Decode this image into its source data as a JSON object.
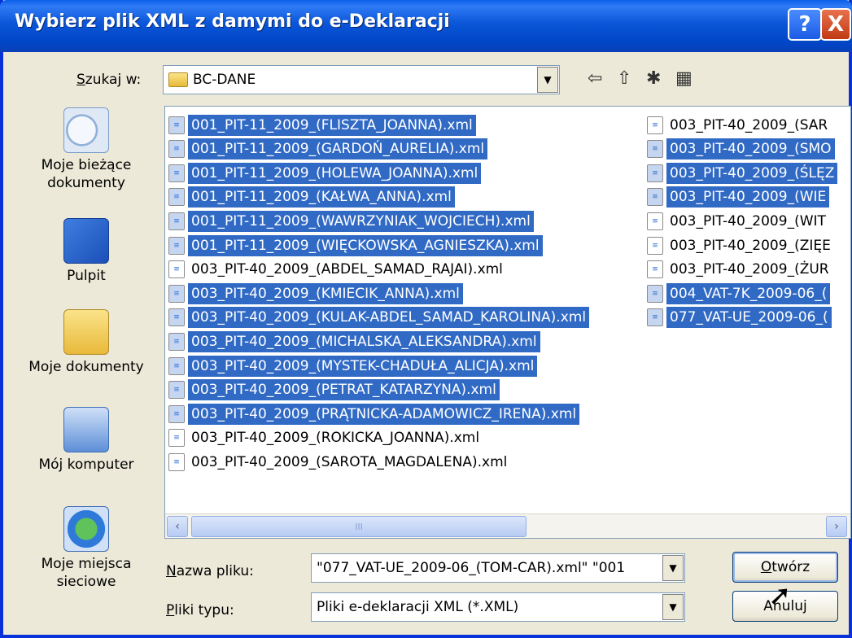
{
  "window": {
    "title": "Wybierz plik XML z damymi do e-Deklaracji"
  },
  "titlebar": {
    "help": "?",
    "close": "X"
  },
  "lookin": {
    "label_prefix": "S",
    "label_rest": "zukaj w:",
    "value": "BC-DANE"
  },
  "places": [
    {
      "name": "Moje bieżące dokumenty",
      "icon": "recent-documents-icon"
    },
    {
      "name": "Pulpit",
      "icon": "desktop-icon"
    },
    {
      "name": "Moje dokumenty",
      "icon": "my-documents-icon"
    },
    {
      "name": "Mój komputer",
      "icon": "my-computer-icon"
    },
    {
      "name": "Moje miejsca sieciowe",
      "icon": "network-places-icon"
    }
  ],
  "files": {
    "col1": [
      {
        "name": "001_PIT-11_2009_(FLISZTA_JOANNA).xml",
        "selected": true
      },
      {
        "name": "001_PIT-11_2009_(GARDOŃ_AURELIA).xml",
        "selected": true
      },
      {
        "name": "001_PIT-11_2009_(HOLEWA_JOANNA).xml",
        "selected": true
      },
      {
        "name": "001_PIT-11_2009_(KAŁWA_ANNA).xml",
        "selected": true
      },
      {
        "name": "001_PIT-11_2009_(WAWRZYNIAK_WOJCIECH).xml",
        "selected": true
      },
      {
        "name": "001_PIT-11_2009_(WIĘCKOWSKA_AGNIESZKA).xml",
        "selected": true
      },
      {
        "name": "003_PIT-40_2009_(ABDEL_SAMAD_RAJAI).xml",
        "selected": false
      },
      {
        "name": "003_PIT-40_2009_(KMIECIK_ANNA).xml",
        "selected": true
      },
      {
        "name": "003_PIT-40_2009_(KULAK-ABDEL_SAMAD_KAROLINA).xml",
        "selected": true
      },
      {
        "name": "003_PIT-40_2009_(MICHALSKA_ALEKSANDRA).xml",
        "selected": true
      },
      {
        "name": "003_PIT-40_2009_(MYSTEK-CHADUŁA_ALICJA).xml",
        "selected": true
      },
      {
        "name": "003_PIT-40_2009_(PETRAT_KATARZYNA).xml",
        "selected": true
      },
      {
        "name": "003_PIT-40_2009_(PRĄTNICKA-ADAMOWICZ_IRENA).xml",
        "selected": true
      },
      {
        "name": "003_PIT-40_2009_(ROKICKA_JOANNA).xml",
        "selected": false
      },
      {
        "name": "003_PIT-40_2009_(SAROTA_MAGDALENA).xml",
        "selected": false
      }
    ],
    "col2": [
      {
        "name": "003_PIT-40_2009_(SAR",
        "selected": false
      },
      {
        "name": "003_PIT-40_2009_(SMO",
        "selected": true
      },
      {
        "name": "003_PIT-40_2009_(ŚLĘZ",
        "selected": true
      },
      {
        "name": "003_PIT-40_2009_(WIE",
        "selected": true
      },
      {
        "name": "003_PIT-40_2009_(WIT",
        "selected": false
      },
      {
        "name": "003_PIT-40_2009_(ZIĘE",
        "selected": false
      },
      {
        "name": "003_PIT-40_2009_(ŻUR",
        "selected": false
      },
      {
        "name": "004_VAT-7K_2009-06_(",
        "selected": true
      },
      {
        "name": "077_VAT-UE_2009-06_(",
        "selected": true
      }
    ]
  },
  "filename": {
    "label_prefix": "N",
    "label_rest": "azwa pliku:",
    "value": "\"077_VAT-UE_2009-06_(TOM-CAR).xml\" \"001"
  },
  "filetype": {
    "label_prefix": "P",
    "label_rest": "liki typu:",
    "value": "Pliki e-deklaracji XML (*.XML)"
  },
  "buttons": {
    "open_prefix": "O",
    "open_rest": "twórz",
    "cancel": "Anuluj"
  },
  "scrollbar": {
    "left": "‹",
    "right": "›",
    "grip": "III"
  }
}
